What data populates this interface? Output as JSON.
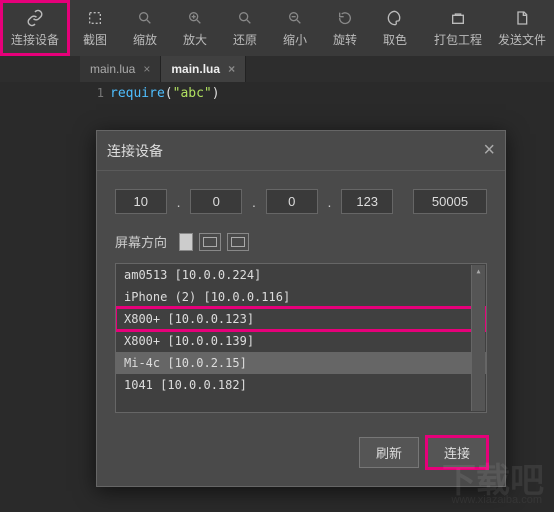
{
  "toolbar": {
    "items": [
      {
        "label": "连接设备",
        "icon": "link-icon",
        "highlighted": true
      },
      {
        "label": "截图",
        "icon": "crop-icon"
      },
      {
        "label": "缩放",
        "icon": "zoom-icon"
      },
      {
        "label": "放大",
        "icon": "zoom-in-icon"
      },
      {
        "label": "还原",
        "icon": "reset-icon"
      },
      {
        "label": "缩小",
        "icon": "zoom-out-icon"
      },
      {
        "label": "旋转",
        "icon": "rotate-icon"
      },
      {
        "label": "取色",
        "icon": "palette-icon"
      },
      {
        "label": "打包工程",
        "icon": "package-icon"
      },
      {
        "label": "发送文件",
        "icon": "send-file-icon"
      }
    ]
  },
  "tabs": [
    {
      "label": "main.lua",
      "active": false
    },
    {
      "label": "main.lua",
      "active": true
    }
  ],
  "editor": {
    "line": "1",
    "keyword": "require",
    "open": "(",
    "string": "\"abc\"",
    "close": ")"
  },
  "dialog": {
    "title": "连接设备",
    "ip": [
      "10",
      "0",
      "0",
      "123"
    ],
    "port": "50005",
    "orient_label": "屏幕方向",
    "devices": [
      "am0513 [10.0.0.224]",
      "iPhone (2) [10.0.0.116]",
      "X800+ [10.0.0.123]",
      "X800+ [10.0.0.139]",
      "Mi-4c [10.0.2.15]",
      "1041 [10.0.0.182]"
    ],
    "selected_index": 2,
    "highlighted_row_index": 4,
    "refresh": "刷新",
    "connect": "连接"
  },
  "watermark": {
    "main": "下载吧",
    "sub": "www.xiazaiba.com"
  }
}
